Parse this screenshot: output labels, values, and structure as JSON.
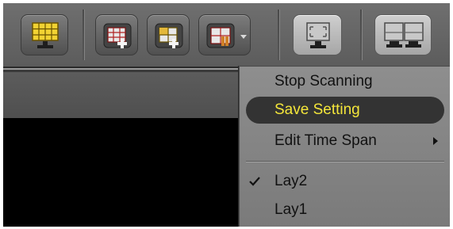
{
  "toolbar": {
    "buttons": [
      {
        "icon": "monitor-grid-icon",
        "state": "active"
      },
      {
        "icon": "add-layout-icon"
      },
      {
        "icon": "add-layout-alt-icon"
      },
      {
        "icon": "layout-dropdown-icon",
        "has_dropdown": true
      },
      {
        "icon": "fullscreen-monitor-icon"
      },
      {
        "icon": "split-monitor-icon"
      }
    ]
  },
  "context_menu": {
    "items": [
      {
        "label": "Stop Scanning"
      },
      {
        "label": "Save Setting",
        "highlighted": true
      },
      {
        "label": "Edit Time Span",
        "has_submenu": true
      },
      {
        "label": "Lay2",
        "checked": true
      },
      {
        "label": "Lay1"
      }
    ]
  },
  "colors": {
    "highlight_text": "#f4e63a",
    "highlight_background": "#333333",
    "menu_background": "#8a8a8a",
    "toolbar_background": "#666666",
    "active_icon": "#f1d233"
  }
}
